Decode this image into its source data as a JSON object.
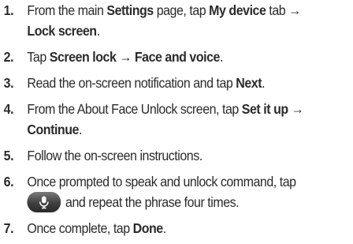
{
  "steps": [
    {
      "num": "1.",
      "p1": "From the main ",
      "b1": "Settings",
      "p2": " page, tap ",
      "b2": "My device",
      "p3": " tab ",
      "b3": "→ Lock screen",
      "p4": "."
    },
    {
      "num": "2.",
      "p1": "Tap ",
      "b1": "Screen lock → Face and voice",
      "p2": "."
    },
    {
      "num": "3.",
      "p1": "Read the on-screen notification and tap ",
      "b1": "Next",
      "p2": "."
    },
    {
      "num": "4.",
      "p1": "From the About Face Unlock screen, tap ",
      "b1": "Set it up → Continue",
      "p2": "."
    },
    {
      "num": "5.",
      "p1": "Follow the on-screen instructions."
    },
    {
      "num": "6.",
      "p1": "Once prompted to speak and unlock command, tap",
      "p2": " and repeat the phrase four times.",
      "icon": "microphone-icon"
    },
    {
      "num": "7.",
      "p1": "Once complete, tap ",
      "b1": "Done",
      "p2": "."
    }
  ]
}
